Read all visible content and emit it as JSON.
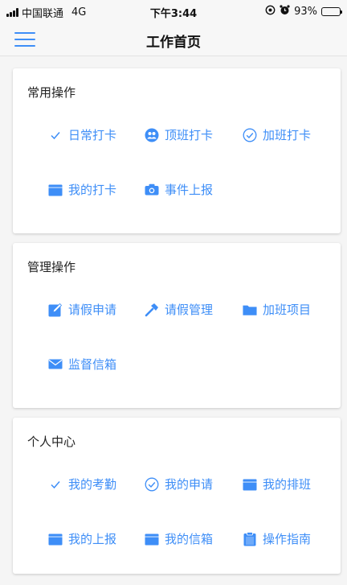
{
  "status_bar": {
    "carrier": "中国联通",
    "network": "4G",
    "time": "下午3:44",
    "battery": "93%",
    "battery_level": 0.93
  },
  "nav": {
    "title": "工作首页",
    "menu_icon": "hamburger-menu-icon"
  },
  "colors": {
    "accent": "#3e8ef7",
    "background": "#f5f5f5",
    "card": "#ffffff"
  },
  "sections": [
    {
      "title": "常用操作",
      "items": [
        {
          "label": "日常打卡",
          "icon": "check-icon"
        },
        {
          "label": "顶班打卡",
          "icon": "users-icon"
        },
        {
          "label": "加班打卡",
          "icon": "check-circle-icon"
        },
        {
          "label": "我的打卡",
          "icon": "calendar-icon"
        },
        {
          "label": "事件上报",
          "icon": "camera-icon"
        }
      ]
    },
    {
      "title": "管理操作",
      "items": [
        {
          "label": "请假申请",
          "icon": "edit-icon"
        },
        {
          "label": "请假管理",
          "icon": "hammer-icon"
        },
        {
          "label": "加班项目",
          "icon": "folder-icon"
        },
        {
          "label": "监督信箱",
          "icon": "mail-icon"
        }
      ]
    },
    {
      "title": "个人中心",
      "items": [
        {
          "label": "我的考勤",
          "icon": "check-icon"
        },
        {
          "label": "我的申请",
          "icon": "check-circle-icon"
        },
        {
          "label": "我的排班",
          "icon": "calendar-icon"
        },
        {
          "label": "我的上报",
          "icon": "calendar-icon"
        },
        {
          "label": "我的信箱",
          "icon": "calendar-icon"
        },
        {
          "label": "操作指南",
          "icon": "clipboard-icon"
        }
      ]
    }
  ]
}
